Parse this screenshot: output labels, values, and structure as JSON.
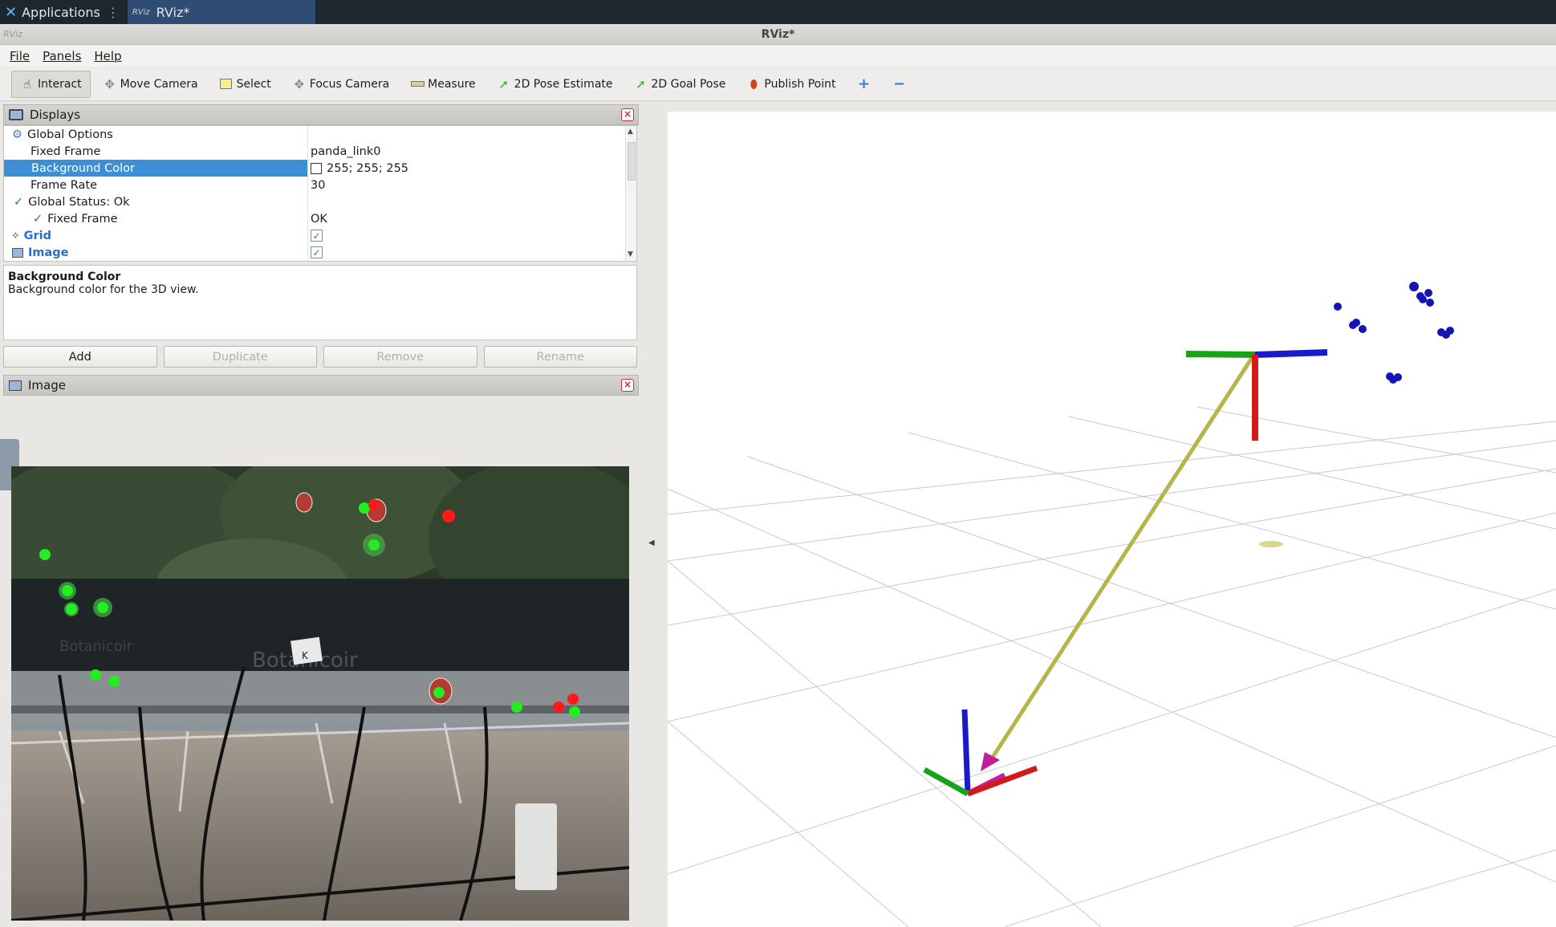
{
  "taskbar": {
    "applications_label": "Applications",
    "window_tab_label": "RViz*",
    "window_tab_icon": "RViz"
  },
  "window": {
    "title": "RViz*",
    "icon_text": "RViz"
  },
  "menu": {
    "file": "File",
    "panels": "Panels",
    "help": "Help"
  },
  "toolbar": {
    "interact": "Interact",
    "move_camera": "Move Camera",
    "select": "Select",
    "focus_camera": "Focus Camera",
    "measure": "Measure",
    "pose_estimate": "2D Pose Estimate",
    "goal_pose": "2D Goal Pose",
    "publish_point": "Publish Point",
    "add_icon": "plus-icon",
    "remove_icon": "minus-icon"
  },
  "displays": {
    "title": "Displays",
    "rows": {
      "global_options": "Global Options",
      "fixed_frame_label": "Fixed Frame",
      "fixed_frame_value": "panda_link0",
      "background_color_label": "Background Color",
      "background_color_value": "255; 255; 255",
      "frame_rate_label": "Frame Rate",
      "frame_rate_value": "30",
      "global_status_label": "Global Status: Ok",
      "status_fixed_frame_label": "Fixed Frame",
      "status_fixed_frame_value": "OK",
      "grid_label": "Grid",
      "image_label": "Image"
    },
    "grid_checked": true,
    "image_checked": true
  },
  "description": {
    "title": "Background Color",
    "text": "Background color for the 3D view."
  },
  "buttons": {
    "add": "Add",
    "duplicate": "Duplicate",
    "remove": "Remove",
    "rename": "Rename"
  },
  "image_panel": {
    "title": "Image",
    "sign_text": "K",
    "background_text_1": "Botanicoir",
    "background_text_2": "Botanicoir"
  },
  "colors": {
    "selection": "#3c8fd4",
    "axis_x": "#d11a1a",
    "axis_y": "#1aa31a",
    "axis_z": "#1a1acc",
    "arrow": "#b5b54a",
    "points": "#1414b4",
    "detect_ripe": "#ff1a1a",
    "detect_unripe": "#22ee22"
  }
}
